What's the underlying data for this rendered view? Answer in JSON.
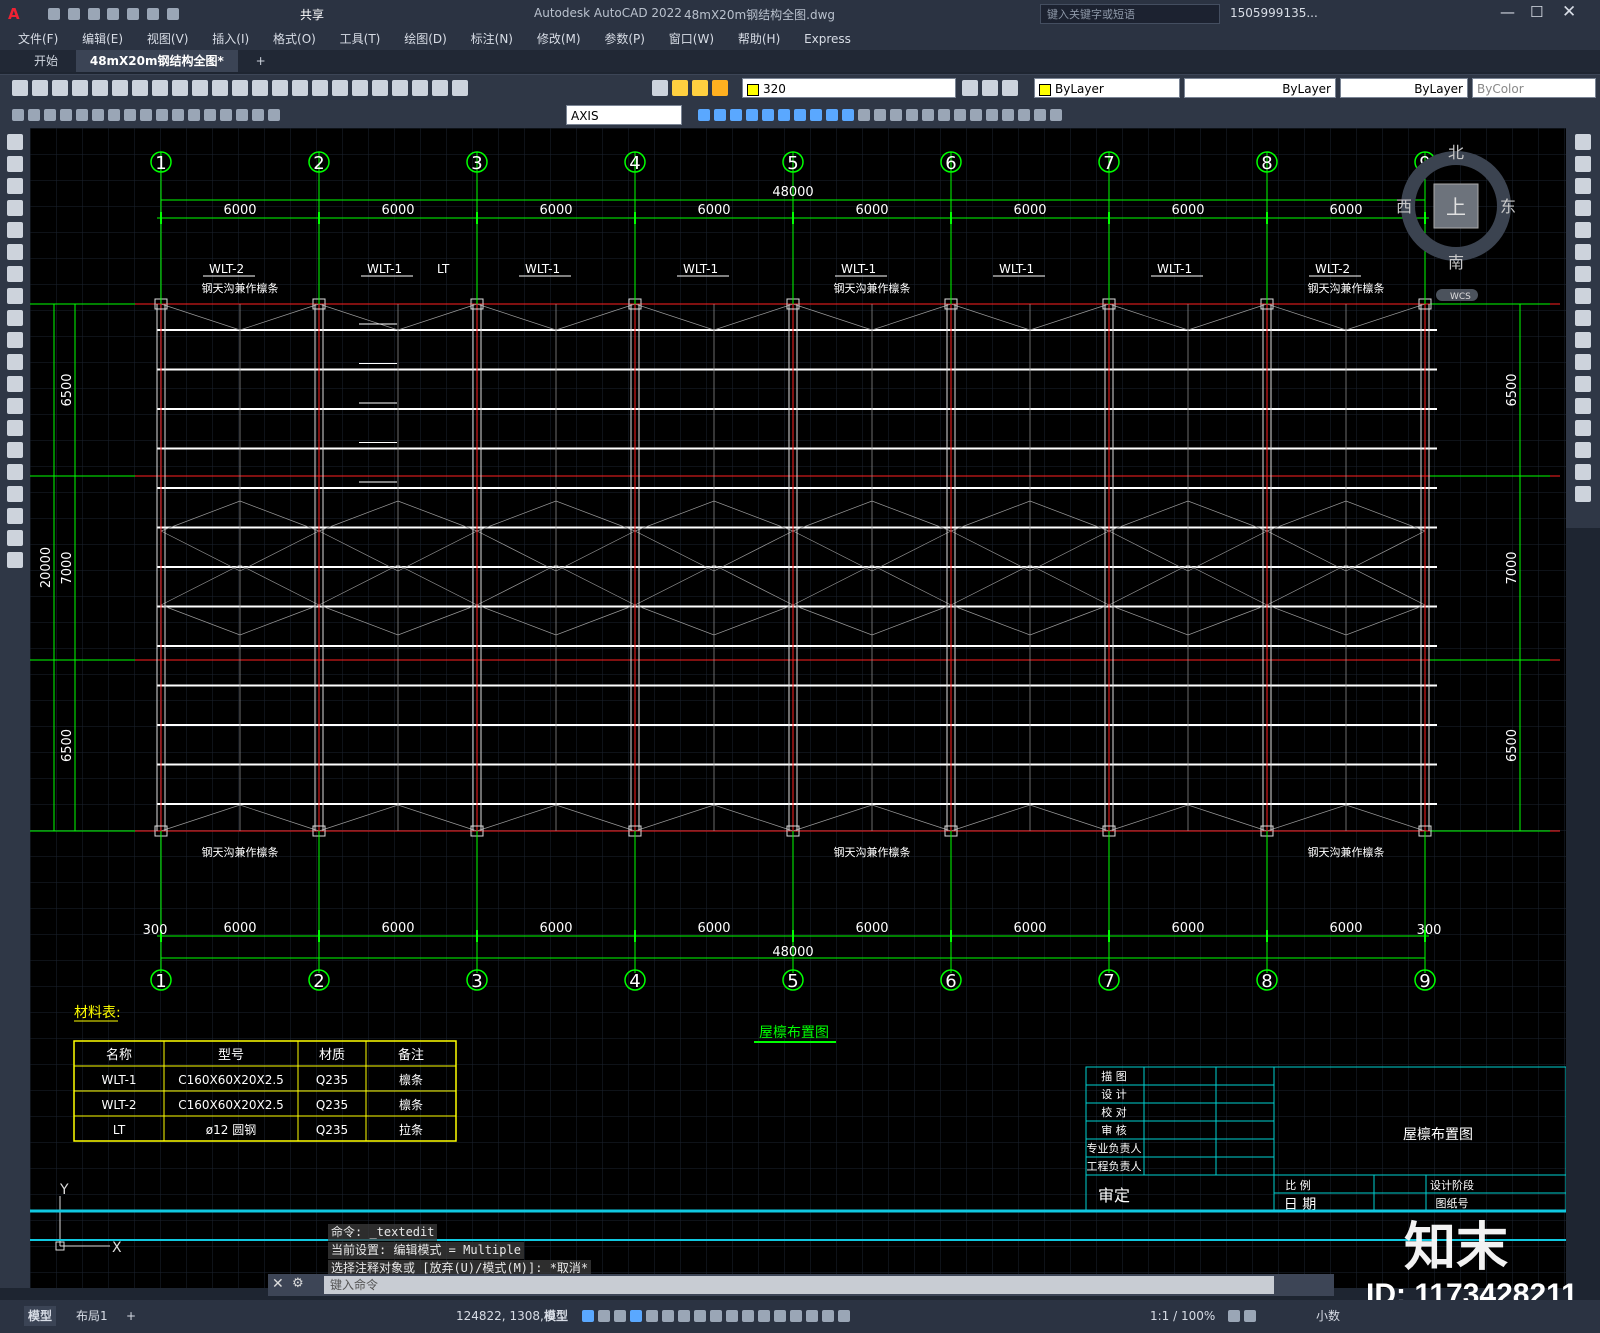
{
  "app": {
    "title": "Autodesk AutoCAD 2022",
    "document": "48mX20m钢结构全图.dwg",
    "share_label": "共享",
    "search_placeholder": "键入关键字或短语",
    "user": "1505999135..."
  },
  "menu": [
    "文件(F)",
    "编辑(E)",
    "视图(V)",
    "插入(I)",
    "格式(O)",
    "工具(T)",
    "绘图(D)",
    "标注(N)",
    "修改(M)",
    "参数(P)",
    "窗口(W)",
    "帮助(H)",
    "Express"
  ],
  "tabs": [
    {
      "label": "开始",
      "active": false
    },
    {
      "label": "48mX20m钢结构全图*",
      "active": true
    }
  ],
  "toolbar": {
    "layer_value": "320",
    "color_value": "ByLayer",
    "linetype_value": "ByLayer",
    "lineweight_value": "ByLayer",
    "plotstyle_value": "ByColor",
    "textstyle_value": "AXIS"
  },
  "viewcube": {
    "north": "北",
    "south": "南",
    "east": "东",
    "west": "西",
    "top": "上",
    "wcs": "WCS"
  },
  "drawing": {
    "axis_labels": [
      "1",
      "2",
      "3",
      "4",
      "5",
      "6",
      "7",
      "8",
      "9"
    ],
    "span_dim": "6000",
    "total_dim": "48000",
    "edge_dim": "300",
    "side_dims": [
      "6500",
      "7000",
      "6500"
    ],
    "total_side_dim": "20000",
    "top_tags": [
      "WLT-2",
      "WLT-1",
      "LT",
      "WLT-1",
      "WLT-1",
      "WLT-1",
      "WLT-1",
      "WLT-1",
      "WLT-2"
    ],
    "note_text": "钢天沟兼作檩条",
    "plan_title": "屋檩布置图",
    "material_title": "材料表:",
    "material_headers": [
      "名称",
      "型号",
      "材质",
      "备注"
    ],
    "material_rows": [
      [
        "WLT-1",
        "C160X60X20X2.5",
        "Q235",
        "檩条"
      ],
      [
        "WLT-2",
        "C160X60X20X2.5",
        "Q235",
        "檩条"
      ],
      [
        "LT",
        "ø12 圆钢",
        "Q235",
        "拉条"
      ]
    ],
    "titleblock_rows": [
      "描 图",
      "设 计",
      "校 对",
      "审 核",
      "专业负责人",
      "工程负责人"
    ],
    "titleblock_name": "屋檩布置图",
    "titleblock_audit": "审定",
    "titleblock_scale": "比 例",
    "titleblock_date": "日 期",
    "titleblock_stage": "设计阶段",
    "titleblock_drawingno": "图纸号",
    "ucs_x": "X",
    "ucs_y": "Y"
  },
  "command": {
    "history": [
      "命令: _textedit",
      "当前设置: 编辑模式 = Multiple",
      "选择注释对象或 [放弃(U)/模式(M)]: *取消*"
    ],
    "placeholder": "键入命令"
  },
  "status": {
    "coords": "124822, 1308, 0",
    "model_label": "模型",
    "scale": "1:1 / 100%",
    "units": "小数",
    "layout_tabs": [
      "模型",
      "布局1"
    ]
  },
  "overlay": {
    "brand": "知末",
    "id": "ID: 1173428211"
  },
  "colors": {
    "axis_green": "#00ff00",
    "bubble_green": "#00ff00",
    "beam_red": "#ff2020",
    "purlin_white": "#ffffff",
    "table_yellow": "#ffff00",
    "titleblock_cyan": "#00d0d0"
  }
}
